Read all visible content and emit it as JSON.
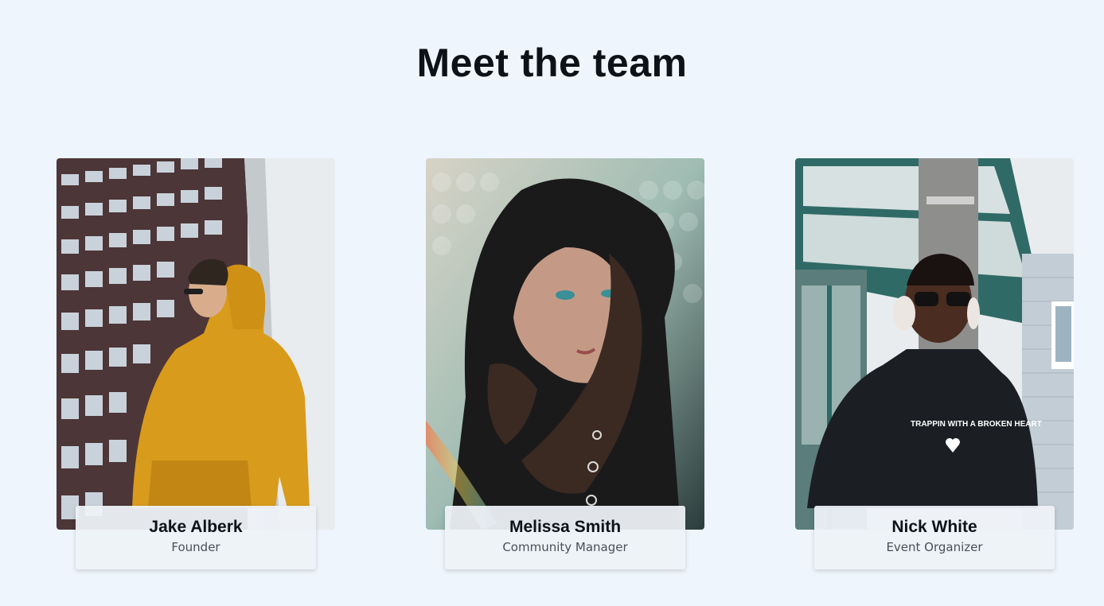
{
  "page": {
    "title": "Meet the team",
    "background": "#eef5fc"
  },
  "team": [
    {
      "name": "Jake Alberk",
      "role": "Founder",
      "photo_subject": "man in yellow hoodie in front of building"
    },
    {
      "name": "Melissa Smith",
      "role": "Community Manager",
      "photo_subject": "woman in black hood"
    },
    {
      "name": "Nick White",
      "role": "Event Organizer",
      "photo_subject": "man with headphones and sunglasses in black hoodie",
      "photo_text": "TRAPPIN WITH A BROKEN HEART"
    }
  ]
}
